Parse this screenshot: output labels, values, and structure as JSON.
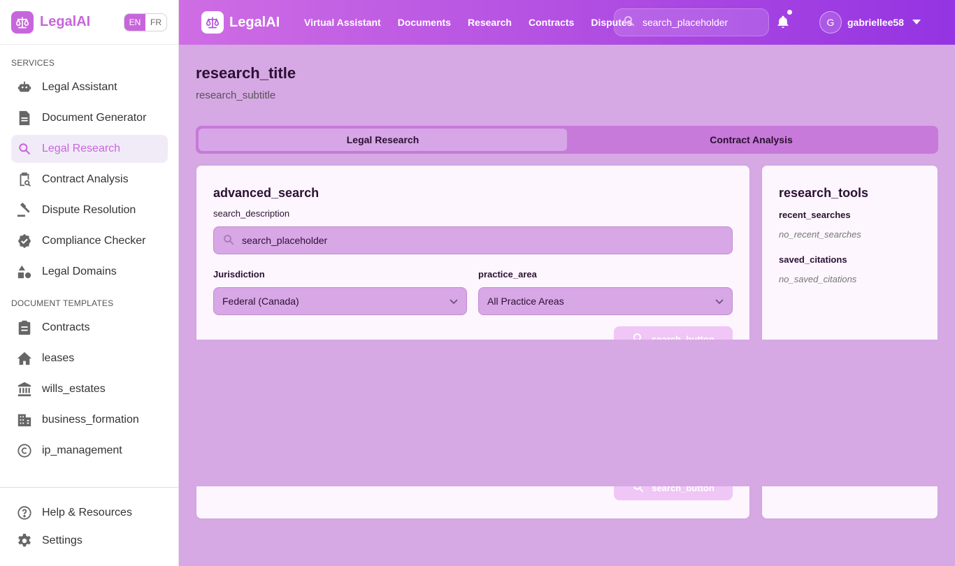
{
  "sidebar": {
    "brand": "LegalAI",
    "lang_en": "EN",
    "lang_fr": "FR",
    "services_heading": "SERVICES",
    "services": [
      {
        "label": "Legal Assistant",
        "icon": "robot-icon"
      },
      {
        "label": "Document Generator",
        "icon": "document-icon"
      },
      {
        "label": "Legal Research",
        "icon": "search-icon",
        "active": true
      },
      {
        "label": "Contract Analysis",
        "icon": "contract-search-icon"
      },
      {
        "label": "Dispute Resolution",
        "icon": "gavel-icon"
      },
      {
        "label": "Compliance Checker",
        "icon": "badge-check-icon"
      },
      {
        "label": "Legal Domains",
        "icon": "shapes-icon"
      }
    ],
    "templates_heading": "DOCUMENT TEMPLATES",
    "templates": [
      {
        "label": "Contracts",
        "icon": "clipboard-icon"
      },
      {
        "label": "leases",
        "icon": "home-icon"
      },
      {
        "label": "wills_estates",
        "icon": "bank-icon"
      },
      {
        "label": "business_formation",
        "icon": "building-icon"
      },
      {
        "label": "ip_management",
        "icon": "copyright-icon"
      }
    ],
    "help": "Help & Resources",
    "settings": "Settings"
  },
  "topbar": {
    "brand": "LegalAI",
    "links": [
      "Virtual Assistant",
      "Documents",
      "Research",
      "Contracts",
      "Disputes"
    ],
    "search_placeholder": "search_placeholder",
    "avatar_initial": "G",
    "username": "gabriellee58"
  },
  "main": {
    "title": "research_title",
    "subtitle": "research_subtitle",
    "tabs": [
      "Legal Research",
      "Contract Analysis"
    ],
    "search_card": {
      "heading": "advanced_search",
      "description": "search_description",
      "search_placeholder": "search_placeholder",
      "jurisdiction_label": "Jurisdiction",
      "jurisdiction_value": "Federal (Canada)",
      "practice_label": "practice_area",
      "practice_value": "All Practice Areas",
      "search_button": "search_button"
    },
    "tools_card": {
      "heading": "research_tools",
      "recent_heading": "recent_searches",
      "recent_empty": "no_recent_searches",
      "saved_heading": "saved_citations",
      "saved_empty": "no_saved_citations"
    }
  },
  "colors": {
    "accent": "#c766dc",
    "topbar_start": "#cf6de4",
    "topbar_end": "#9434e2",
    "page_bg": "#d6a8e4"
  }
}
